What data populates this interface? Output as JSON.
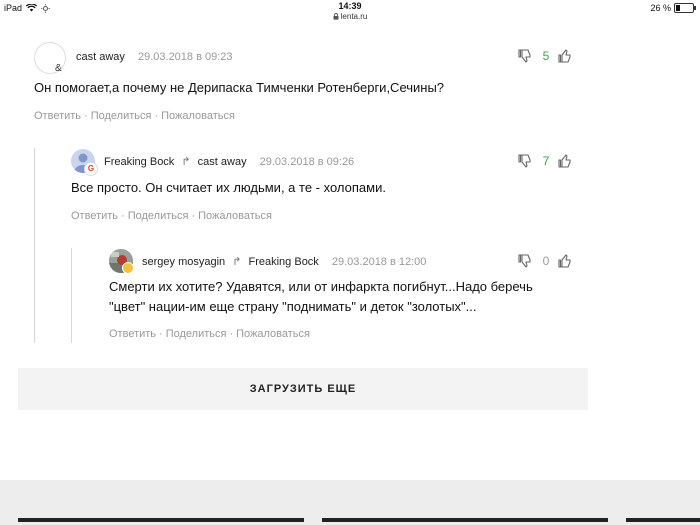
{
  "status_bar": {
    "device": "iPad",
    "time": "14:39",
    "url": "lenta.ru",
    "battery": "26 %",
    "battery_level": 0.26
  },
  "comments": [
    {
      "author": "cast away",
      "reply_to": "",
      "date": "29.03.2018 в 09:23",
      "text": "Он помогает,а почему не Дерипаска Тимченки Ротенберги,Сечины?",
      "votes": "5",
      "votes_color": "#3aa53a",
      "avatar_badge": "&",
      "actions": [
        "Ответить",
        "Поделиться",
        "Пожаловаться"
      ]
    },
    {
      "author": "Freaking Bock",
      "reply_to": "cast away",
      "date": "29.03.2018 в 09:26",
      "text": "Все просто. Он считает их людьми, а те - холопами.",
      "votes": "7",
      "votes_color": "#3aa53a",
      "avatar_badge": "G",
      "actions": [
        "Ответить",
        "Поделиться",
        "Пожаловаться"
      ]
    },
    {
      "author": "sergey mosyagin",
      "reply_to": "Freaking Bock",
      "date": "29.03.2018 в 12:00",
      "text_line1": "Смерти их хотите? Удавятся, или от инфаркта погибнут...Надо беречь",
      "text_line2": "\"цвет\" нации-им еще страну \"поднимать\" и деток \"золотых\"...",
      "votes": "0",
      "votes_color": "#999999",
      "actions": [
        "Ответить",
        "Поделиться",
        "Пожаловаться"
      ]
    }
  ],
  "load_more": "ЗАГРУЗИТЬ ЕЩЕ",
  "icons": {
    "thumb_down": "thumbs-down-icon",
    "thumb_up": "thumbs-up-icon",
    "reply": "reply-arrow-icon"
  }
}
